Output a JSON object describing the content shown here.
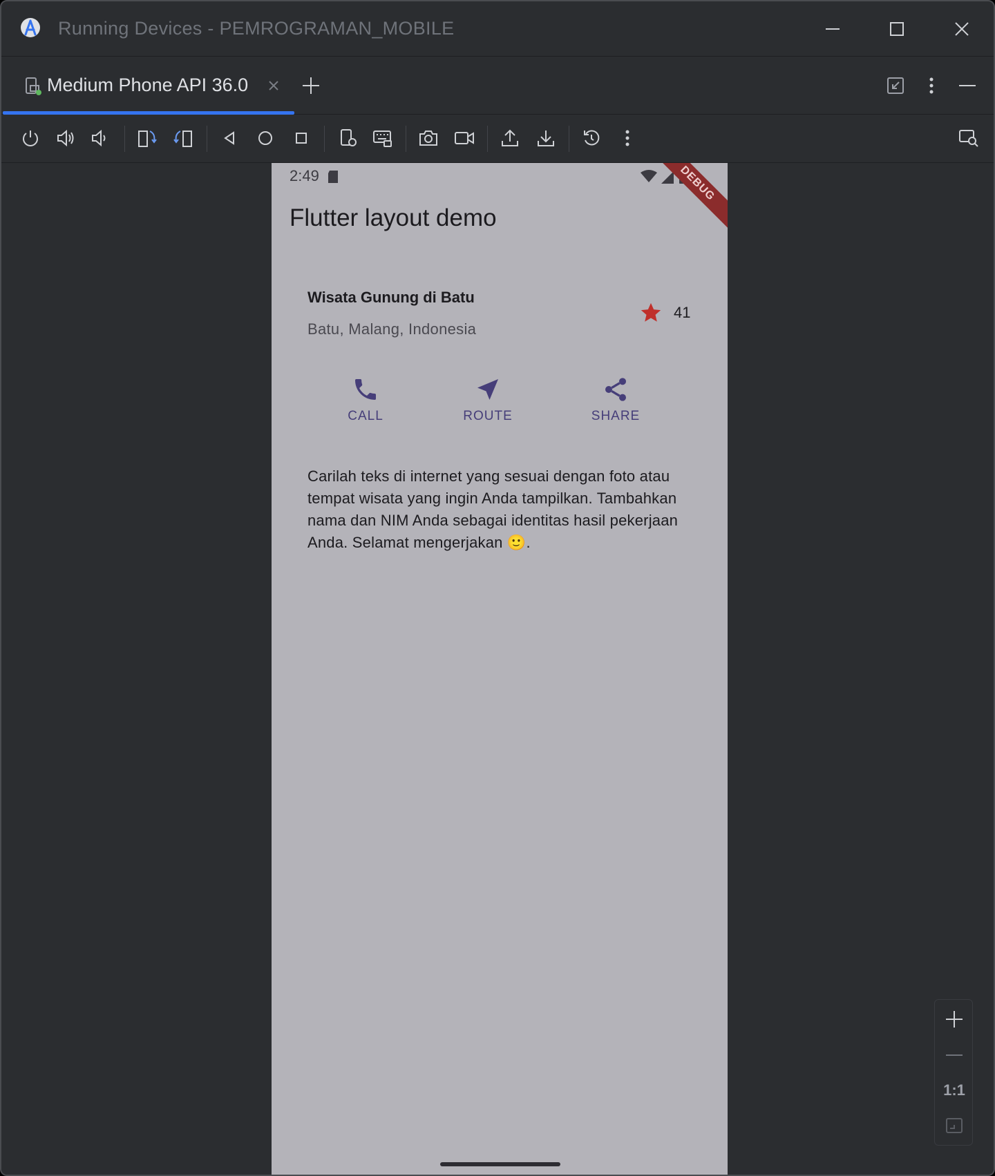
{
  "window": {
    "title": "Running Devices - PEMROGRAMAN_MOBILE"
  },
  "tabs": [
    {
      "label": "Medium Phone API 36.0",
      "icon": "device-tab-icon",
      "active": true
    }
  ],
  "toolbar": {
    "icons": [
      "power-icon",
      "volume-up-icon",
      "volume-down-icon",
      "rotate-left-icon",
      "rotate-right-icon",
      "back-icon",
      "home-icon",
      "overview-icon",
      "device-settings-icon",
      "keyboard-icon",
      "screenshot-icon",
      "screen-record-icon",
      "upload-icon",
      "download-icon",
      "reset-icon",
      "more-icon",
      "inspect-icon"
    ]
  },
  "phone": {
    "status_time": "2:49",
    "debug_banner": "DEBUG",
    "app_title": "Flutter layout demo",
    "place_title": "Wisata Gunung di Batu",
    "place_subtitle": "Batu, Malang, Indonesia",
    "star_count": "41",
    "actions": [
      {
        "label": "CALL",
        "icon": "phone-icon"
      },
      {
        "label": "ROUTE",
        "icon": "navigation-icon"
      },
      {
        "label": "SHARE",
        "icon": "share-icon"
      }
    ],
    "description": "Carilah teks di internet yang sesuai dengan foto atau tempat wisata yang ingin Anda tampilkan. Tambahkan nama dan NIM Anda sebagai identitas hasil pekerjaan Anda. Selamat mengerjakan 🙂.",
    "colors": {
      "background": "#b4b3b9",
      "accent": "#463e79",
      "star": "#c0302b"
    }
  },
  "zoom": {
    "actual_size_label": "1:1"
  }
}
